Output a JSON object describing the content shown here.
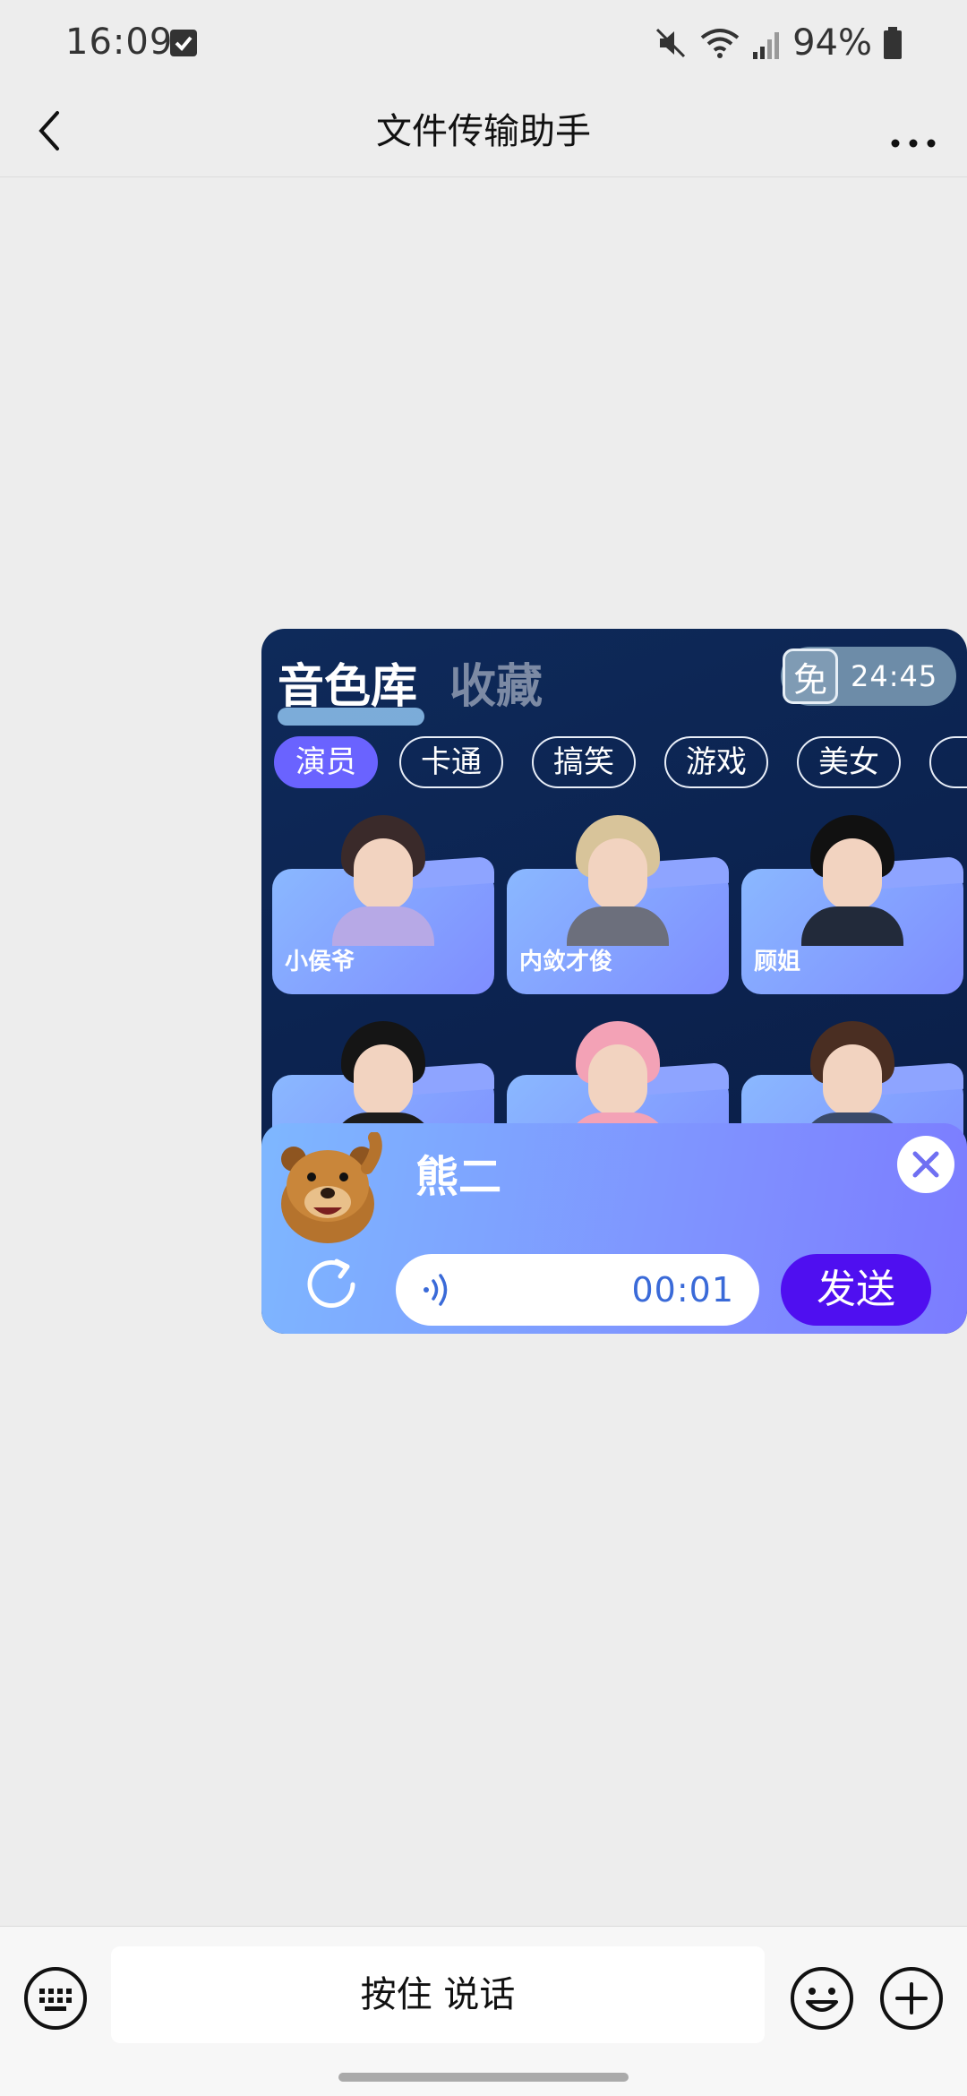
{
  "status_bar": {
    "time": "16:09",
    "battery": "94%",
    "icons": [
      "check-icon",
      "mute-icon",
      "wifi-icon",
      "signal-icon",
      "battery-icon"
    ]
  },
  "nav": {
    "title": "文件传输助手",
    "back_icon": "chevron-left-icon",
    "more_icon": "more-icon"
  },
  "voice_library": {
    "tab_library": "音色库",
    "tab_favorites": "收藏",
    "free_badge_icon_text": "免",
    "free_time": "24:45",
    "categories": [
      "演员",
      "卡通",
      "搞笑",
      "游戏",
      "美女"
    ],
    "active_category": "演员",
    "voices": [
      {
        "name": "小侯爷"
      },
      {
        "name": "内敛才俊"
      },
      {
        "name": "顾姐"
      },
      {
        "name": ""
      },
      {
        "name": ""
      },
      {
        "name": ""
      }
    ],
    "selected": {
      "name": "熊二",
      "duration": "00:01",
      "send_label": "发送"
    }
  },
  "input_bar": {
    "hold_to_talk": "按住 说话"
  },
  "colors": {
    "accent_purple": "#4f0ff0",
    "chip_active": "#6a63ff",
    "card_bg": "#0c2350",
    "page_bg": "#ededed"
  }
}
